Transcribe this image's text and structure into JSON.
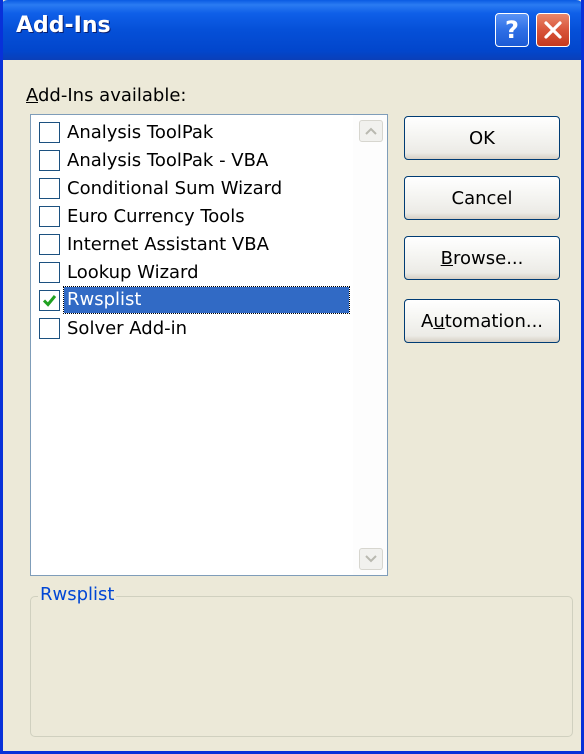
{
  "window": {
    "title": "Add-Ins",
    "help_label": "?"
  },
  "list": {
    "label": "Add-Ins available:",
    "items": [
      {
        "label": "Analysis ToolPak",
        "checked": false,
        "selected": false
      },
      {
        "label": "Analysis ToolPak - VBA",
        "checked": false,
        "selected": false
      },
      {
        "label": "Conditional Sum Wizard",
        "checked": false,
        "selected": false
      },
      {
        "label": "Euro Currency Tools",
        "checked": false,
        "selected": false
      },
      {
        "label": "Internet Assistant VBA",
        "checked": false,
        "selected": false
      },
      {
        "label": "Lookup Wizard",
        "checked": false,
        "selected": false
      },
      {
        "label": "Rwsplist",
        "checked": true,
        "selected": true
      },
      {
        "label": "Solver Add-in",
        "checked": false,
        "selected": false
      }
    ]
  },
  "buttons": {
    "ok": "OK",
    "cancel": "Cancel",
    "browse": "Browse...",
    "automation": "Automation..."
  },
  "description": {
    "title": "Rwsplist",
    "text": ""
  },
  "colors": {
    "titlebar": "#0550D8",
    "selection": "#316AC5",
    "checkmark": "#21A121",
    "group_title": "#0046D5"
  }
}
